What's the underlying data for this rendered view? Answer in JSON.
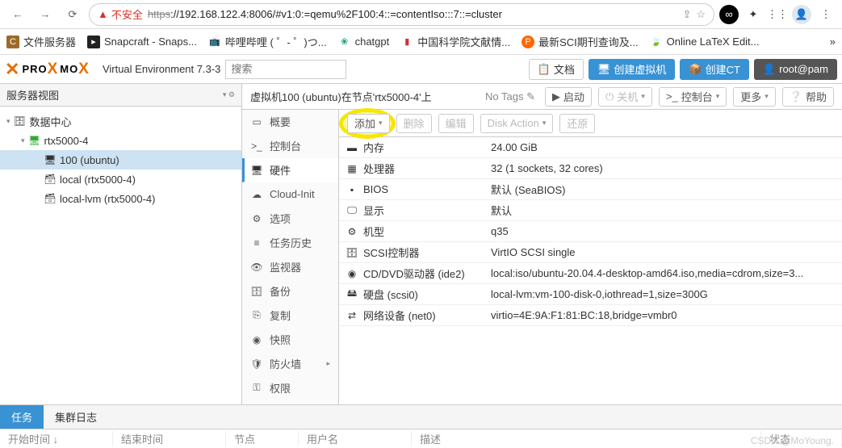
{
  "browser": {
    "insecure_label": "不安全",
    "url_prefix": "https",
    "url_rest": "://192.168.122.4:8006/#v1:0:=qemu%2F100:4::=contentIso:::7::=cluster"
  },
  "bookmarks": [
    {
      "label": "文件服务器",
      "color": "#9c6b2b"
    },
    {
      "label": "Snapcraft - Snaps...",
      "color": "#222"
    },
    {
      "label": "哔哩哔哩 (  ゜- ゜)つ...",
      "color": "#44a0d3"
    },
    {
      "label": "chatgpt",
      "color": "#10a37f"
    },
    {
      "label": "中国科学院文献情...",
      "color": "#c33"
    },
    {
      "label": "最新SCI期刊查询及...",
      "color": "#f60"
    },
    {
      "label": "Online LaTeX Edit...",
      "color": "#4a4"
    }
  ],
  "header": {
    "product": "Virtual Environment 7.3-3",
    "search_placeholder": "搜索",
    "docs": "文档",
    "create_vm": "创建虚拟机",
    "create_ct": "创建CT",
    "user": "root@pam"
  },
  "tree": {
    "header": "服务器视图",
    "nodes": {
      "datacenter": "数据中心",
      "node": "rtx5000-4",
      "vm": "100 (ubuntu)",
      "local": "local (rtx5000-4)",
      "locallvm": "local-lvm (rtx5000-4)"
    }
  },
  "content": {
    "title_prefix": "虚拟机100 (ubuntu)在节点'rtx5000-4'上",
    "notags": "No Tags",
    "buttons": {
      "start": "启动",
      "shutdown": "关机",
      "console": "控制台",
      "more": "更多",
      "help": "帮助"
    }
  },
  "tabs": [
    "概要",
    "控制台",
    "硬件",
    "Cloud-Init",
    "选项",
    "任务历史",
    "监视器",
    "备份",
    "复制",
    "快照",
    "防火墙",
    "权限"
  ],
  "hw_toolbar": {
    "add": "添加",
    "remove": "删除",
    "edit": "编辑",
    "disk_action": "Disk Action",
    "revert": "还原"
  },
  "hw_rows": [
    {
      "icon": "memory",
      "label": "内存",
      "value": "24.00 GiB"
    },
    {
      "icon": "cpu",
      "label": "处理器",
      "value": "32 (1 sockets, 32 cores)"
    },
    {
      "icon": "bios",
      "label": "BIOS",
      "value": "默认 (SeaBIOS)"
    },
    {
      "icon": "display",
      "label": "显示",
      "value": "默认"
    },
    {
      "icon": "machine",
      "label": "机型",
      "value": "q35"
    },
    {
      "icon": "scsi",
      "label": "SCSI控制器",
      "value": "VirtIO SCSI single"
    },
    {
      "icon": "cd",
      "label": "CD/DVD驱动器 (ide2)",
      "value": "local:iso/ubuntu-20.04.4-desktop-amd64.iso,media=cdrom,size=3..."
    },
    {
      "icon": "disk",
      "label": "硬盘 (scsi0)",
      "value": "local-lvm:vm-100-disk-0,iothread=1,size=300G"
    },
    {
      "icon": "net",
      "label": "网络设备 (net0)",
      "value": "virtio=4E:9A:F1:81:BC:18,bridge=vmbr0"
    }
  ],
  "bottom": {
    "tasks": "任务",
    "cluster_log": "集群日志"
  },
  "log_cols": [
    "开始时间 ↓",
    "结束时间",
    "节点",
    "用户名",
    "描述",
    "状态"
  ],
  "watermark": "CSDN @MoYoung."
}
